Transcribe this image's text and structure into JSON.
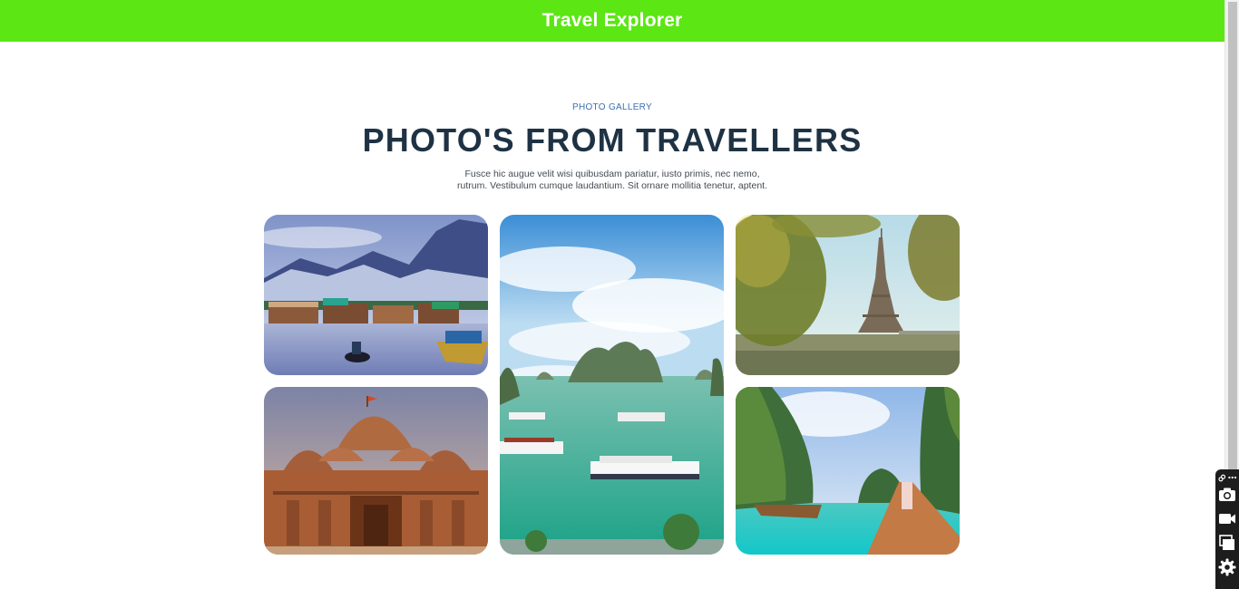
{
  "header": {
    "title": "Travel Explorer"
  },
  "section": {
    "eyebrow": "PHOTO GALLERY",
    "title": "PHOTO'S FROM TRAVELLERS",
    "description_line1": "Fusce hic augue velit wisi quibusdam pariatur, iusto primis, nec nemo,",
    "description_line2": "rutrum. Vestibulum cumque laudantium. Sit ornare mollitia tenetur, aptent."
  },
  "gallery": {
    "photos": [
      {
        "name": "lake-houseboats-mountains"
      },
      {
        "name": "bay-limestone-islands-boats"
      },
      {
        "name": "eiffel-tower-river-trees"
      },
      {
        "name": "carved-sandstone-temple"
      },
      {
        "name": "tropical-cliffs-longtail-boat"
      }
    ]
  },
  "toolbar": {
    "icons": [
      "link-icon",
      "more-icon",
      "camera-icon",
      "video-icon",
      "layers-icon",
      "gear-icon"
    ]
  },
  "colors": {
    "header_bg": "#5ce614",
    "title": "#1e3244",
    "eyebrow": "#3a6fb0"
  }
}
